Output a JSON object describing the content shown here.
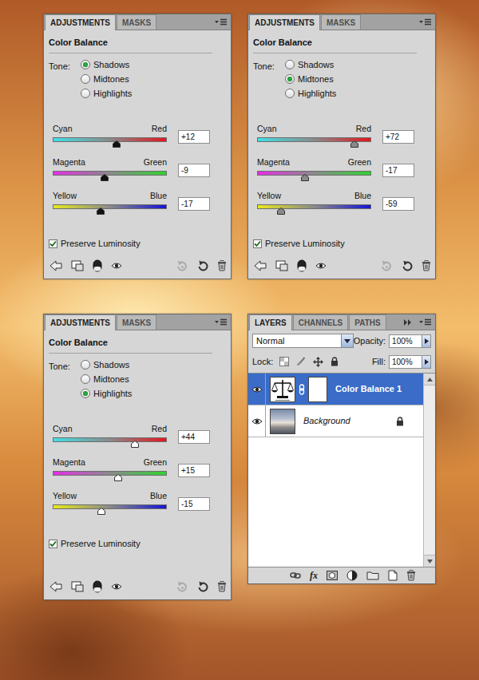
{
  "adjustment_panels": [
    {
      "tabs": [
        {
          "label": "ADJUSTMENTS",
          "selected": true
        },
        {
          "label": "MASKS",
          "selected": false
        }
      ],
      "title": "Color Balance",
      "tone_label": "Tone:",
      "tones": [
        {
          "label": "Shadows",
          "selected": true
        },
        {
          "label": "Midtones",
          "selected": false
        },
        {
          "label": "Highlights",
          "selected": false
        }
      ],
      "sliders": [
        {
          "left": "Cyan",
          "right": "Red",
          "value": "+12",
          "level": 0.56
        },
        {
          "left": "Magenta",
          "right": "Green",
          "value": "-9",
          "level": 0.455
        },
        {
          "left": "Yellow",
          "right": "Blue",
          "value": "-17",
          "level": 0.415
        }
      ],
      "preserve": {
        "label": "Preserve Luminosity",
        "checked": true
      }
    },
    {
      "tabs": [
        {
          "label": "ADJUSTMENTS",
          "selected": true
        },
        {
          "label": "MASKS",
          "selected": false
        }
      ],
      "title": "Color Balance",
      "tone_label": "Tone:",
      "tones": [
        {
          "label": "Shadows",
          "selected": false
        },
        {
          "label": "Midtones",
          "selected": true
        },
        {
          "label": "Highlights",
          "selected": false
        }
      ],
      "sliders": [
        {
          "left": "Cyan",
          "right": "Red",
          "value": "+72",
          "level": 0.86
        },
        {
          "left": "Magenta",
          "right": "Green",
          "value": "-17",
          "level": 0.415
        },
        {
          "left": "Yellow",
          "right": "Blue",
          "value": "-59",
          "level": 0.205
        }
      ],
      "preserve": {
        "label": "Preserve Luminosity",
        "checked": true
      }
    },
    {
      "tabs": [
        {
          "label": "ADJUSTMENTS",
          "selected": true
        },
        {
          "label": "MASKS",
          "selected": false
        }
      ],
      "title": "Color Balance",
      "tone_label": "Tone:",
      "tones": [
        {
          "label": "Shadows",
          "selected": false
        },
        {
          "label": "Midtones",
          "selected": false
        },
        {
          "label": "Highlights",
          "selected": true
        }
      ],
      "sliders": [
        {
          "left": "Cyan",
          "right": "Red",
          "value": "+44",
          "level": 0.72
        },
        {
          "left": "Magenta",
          "right": "Green",
          "value": "+15",
          "level": 0.575
        },
        {
          "left": "Yellow",
          "right": "Blue",
          "value": "-15",
          "level": 0.425
        }
      ],
      "preserve": {
        "label": "Preserve Luminosity",
        "checked": true
      }
    }
  ],
  "layers_panel": {
    "tabs": [
      {
        "label": "LAYERS",
        "selected": true
      },
      {
        "label": "CHANNELS",
        "selected": false
      },
      {
        "label": "PATHS",
        "selected": false
      }
    ],
    "blend_mode": "Normal",
    "opacity_label": "Opacity:",
    "opacity": "100%",
    "lock_label": "Lock:",
    "fill_label": "Fill:",
    "fill": "100%",
    "layers": [
      {
        "name": "Color Balance 1",
        "kind": "adjustment",
        "selected": true,
        "visible": true,
        "locked": false
      },
      {
        "name": "Background",
        "kind": "image",
        "selected": false,
        "visible": true,
        "locked": true
      }
    ],
    "fx_button": "fx"
  }
}
